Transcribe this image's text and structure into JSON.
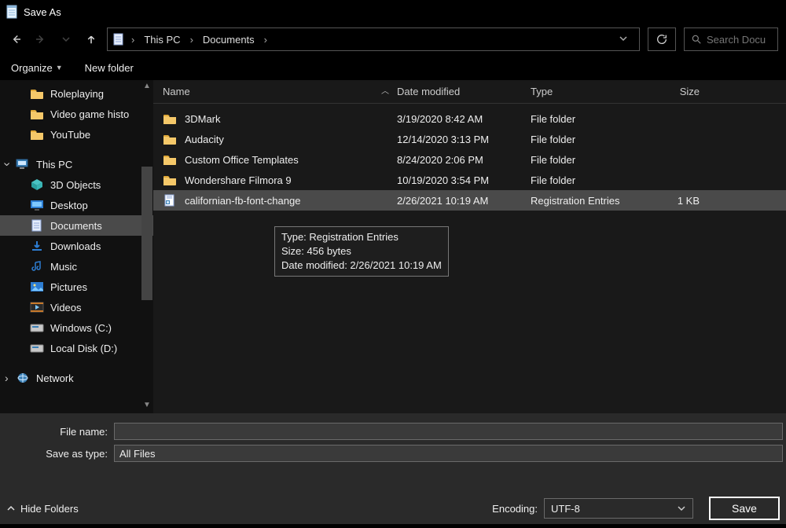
{
  "title": "Save As",
  "breadcrumb": {
    "root": "This PC",
    "folder": "Documents"
  },
  "search": {
    "placeholder": "Search Docu"
  },
  "commands": {
    "organize": "Organize",
    "new_folder": "New folder"
  },
  "sidebar": {
    "quick": [
      {
        "label": "Roleplaying"
      },
      {
        "label": "Video game histo"
      },
      {
        "label": "YouTube"
      }
    ],
    "thispc": "This PC",
    "thispc_children": [
      {
        "label": "3D Objects"
      },
      {
        "label": "Desktop"
      },
      {
        "label": "Documents",
        "selected": true
      },
      {
        "label": "Downloads"
      },
      {
        "label": "Music"
      },
      {
        "label": "Pictures"
      },
      {
        "label": "Videos"
      },
      {
        "label": "Windows (C:)"
      },
      {
        "label": "Local Disk (D:)"
      }
    ],
    "network": "Network"
  },
  "columns": {
    "name": "Name",
    "date": "Date modified",
    "type": "Type",
    "size": "Size"
  },
  "files": [
    {
      "name": "3DMark",
      "date": "3/19/2020 8:42 AM",
      "type": "File folder",
      "size": "",
      "kind": "folder"
    },
    {
      "name": "Audacity",
      "date": "12/14/2020 3:13 PM",
      "type": "File folder",
      "size": "",
      "kind": "folder"
    },
    {
      "name": "Custom Office Templates",
      "date": "8/24/2020 2:06 PM",
      "type": "File folder",
      "size": "",
      "kind": "folder"
    },
    {
      "name": "Wondershare Filmora 9",
      "date": "10/19/2020 3:54 PM",
      "type": "File folder",
      "size": "",
      "kind": "folder"
    },
    {
      "name": "californian-fb-font-change",
      "date": "2/26/2021 10:19 AM",
      "type": "Registration Entries",
      "size": "1 KB",
      "kind": "reg",
      "selected": true
    }
  ],
  "tooltip": {
    "line1": "Type: Registration Entries",
    "line2": "Size: 456 bytes",
    "line3": "Date modified: 2/26/2021 10:19 AM"
  },
  "form": {
    "filename_label": "File name:",
    "filename_value": "",
    "savetype_label": "Save as type:",
    "savetype_value": "All Files"
  },
  "bottom": {
    "hide_folders": "Hide Folders",
    "encoding_label": "Encoding:",
    "encoding_value": "UTF-8",
    "save": "Save"
  }
}
